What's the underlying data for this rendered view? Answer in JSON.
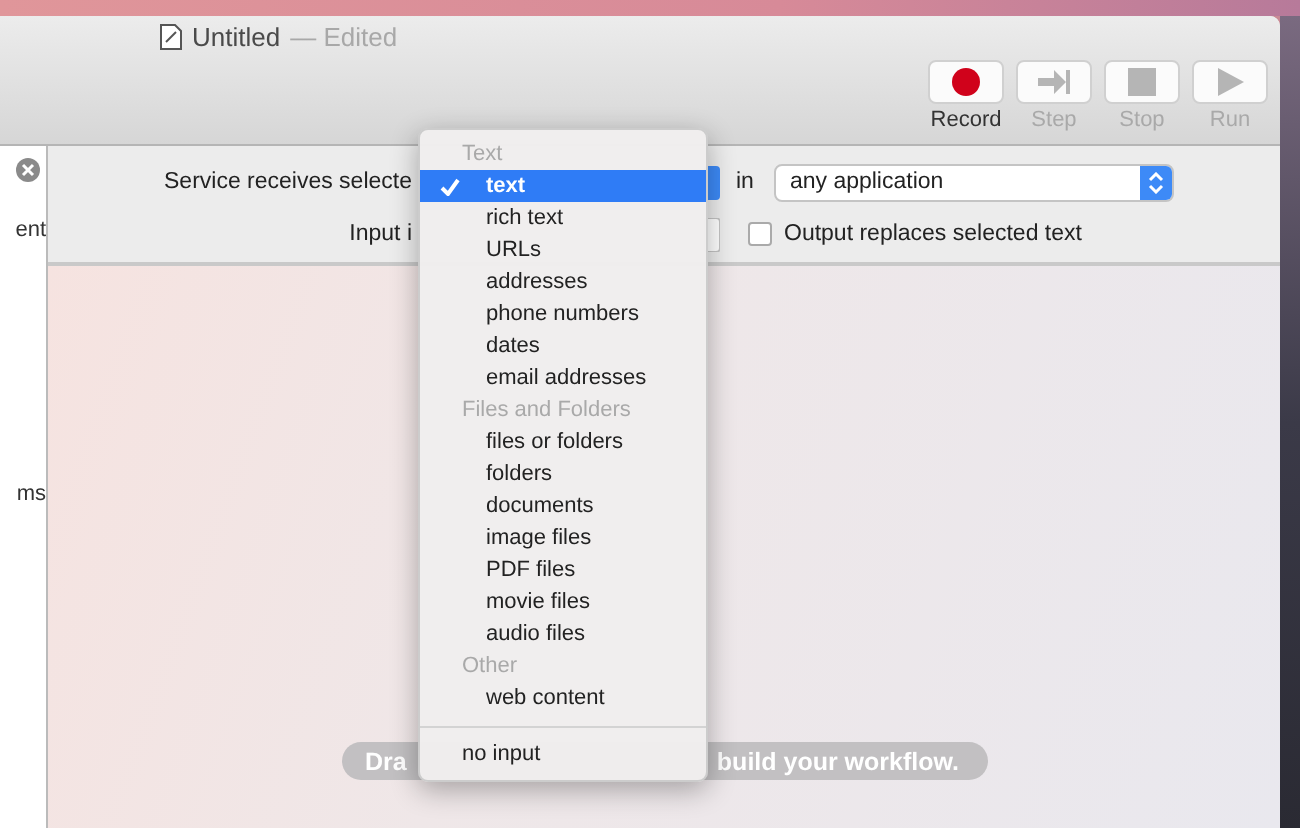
{
  "window": {
    "title": "Untitled",
    "status": "— Edited"
  },
  "toolbar": [
    {
      "kind": "record",
      "label": "Record",
      "disabled": false
    },
    {
      "kind": "step",
      "label": "Step",
      "disabled": true
    },
    {
      "kind": "stop",
      "label": "Stop",
      "disabled": true
    },
    {
      "kind": "run",
      "label": "Run",
      "disabled": true
    }
  ],
  "sidebar": {
    "items": [
      "ent",
      "ms"
    ]
  },
  "header": {
    "receives_label": "Service receives selecte",
    "in_label": "in",
    "application": "any application",
    "input_label": "Input i",
    "output_replaces": {
      "label": "Output replaces selected text",
      "checked": false
    }
  },
  "hint": {
    "parts": [
      "Dra",
      "build your workflow."
    ]
  },
  "menu": {
    "groups": [
      {
        "header": "Text",
        "items": [
          {
            "label": "text",
            "selected": true
          },
          {
            "label": "rich text",
            "selected": false
          },
          {
            "label": "URLs",
            "selected": false
          },
          {
            "label": "addresses",
            "selected": false
          },
          {
            "label": "phone numbers",
            "selected": false
          },
          {
            "label": "dates",
            "selected": false
          },
          {
            "label": "email addresses",
            "selected": false
          }
        ]
      },
      {
        "header": "Files and Folders",
        "items": [
          {
            "label": "files or folders",
            "selected": false
          },
          {
            "label": "folders",
            "selected": false
          },
          {
            "label": "documents",
            "selected": false
          },
          {
            "label": "image files",
            "selected": false
          },
          {
            "label": "PDF files",
            "selected": false
          },
          {
            "label": "movie files",
            "selected": false
          },
          {
            "label": "audio files",
            "selected": false
          }
        ]
      },
      {
        "header": "Other",
        "items": [
          {
            "label": "web content",
            "selected": false
          }
        ]
      }
    ],
    "footer": {
      "label": "no input",
      "selected": false
    }
  }
}
